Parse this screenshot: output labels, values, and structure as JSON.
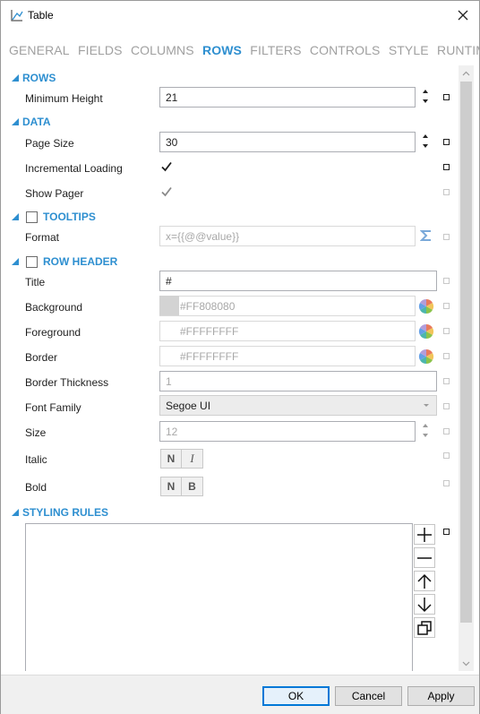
{
  "window": {
    "title": "Table"
  },
  "tabs": [
    {
      "label": "GENERAL",
      "active": false
    },
    {
      "label": "FIELDS",
      "active": false
    },
    {
      "label": "COLUMNS",
      "active": false
    },
    {
      "label": "ROWS",
      "active": true
    },
    {
      "label": "FILTERS",
      "active": false
    },
    {
      "label": "CONTROLS",
      "active": false
    },
    {
      "label": "STYLE",
      "active": false
    },
    {
      "label": "RUNTIME",
      "active": false
    }
  ],
  "sections": {
    "rows": {
      "title": "ROWS",
      "minimum_height": {
        "label": "Minimum Height",
        "value": "21"
      }
    },
    "data": {
      "title": "DATA",
      "page_size": {
        "label": "Page Size",
        "value": "30"
      },
      "incremental_loading": {
        "label": "Incremental Loading",
        "checked": true
      },
      "show_pager": {
        "label": "Show Pager",
        "checked": true,
        "enabled": false
      }
    },
    "tooltips": {
      "title": "TOOLTIPS",
      "checked": false,
      "format": {
        "label": "Format",
        "value": "x={{@@value}}"
      }
    },
    "row_header": {
      "title": "ROW HEADER",
      "checked": false,
      "title_field": {
        "label": "Title",
        "value": "#"
      },
      "background": {
        "label": "Background",
        "value": "#FF808080",
        "swatch": "#d3d3d3"
      },
      "foreground": {
        "label": "Foreground",
        "value": "#FFFFFFFF"
      },
      "border": {
        "label": "Border",
        "value": "#FFFFFFFF"
      },
      "border_thickness": {
        "label": "Border Thickness",
        "value": "1"
      },
      "font_family": {
        "label": "Font Family",
        "value": "Segoe UI"
      },
      "size": {
        "label": "Size",
        "value": "12"
      },
      "italic": {
        "label": "Italic",
        "normal": "N",
        "italic": "I"
      },
      "bold": {
        "label": "Bold",
        "normal": "N",
        "bold": "B"
      }
    },
    "styling_rules": {
      "title": "STYLING RULES"
    }
  },
  "footer": {
    "ok": "OK",
    "cancel": "Cancel",
    "apply": "Apply"
  },
  "colors": {
    "accent": "#2e8fd0",
    "default_button_border": "#0078d7"
  }
}
